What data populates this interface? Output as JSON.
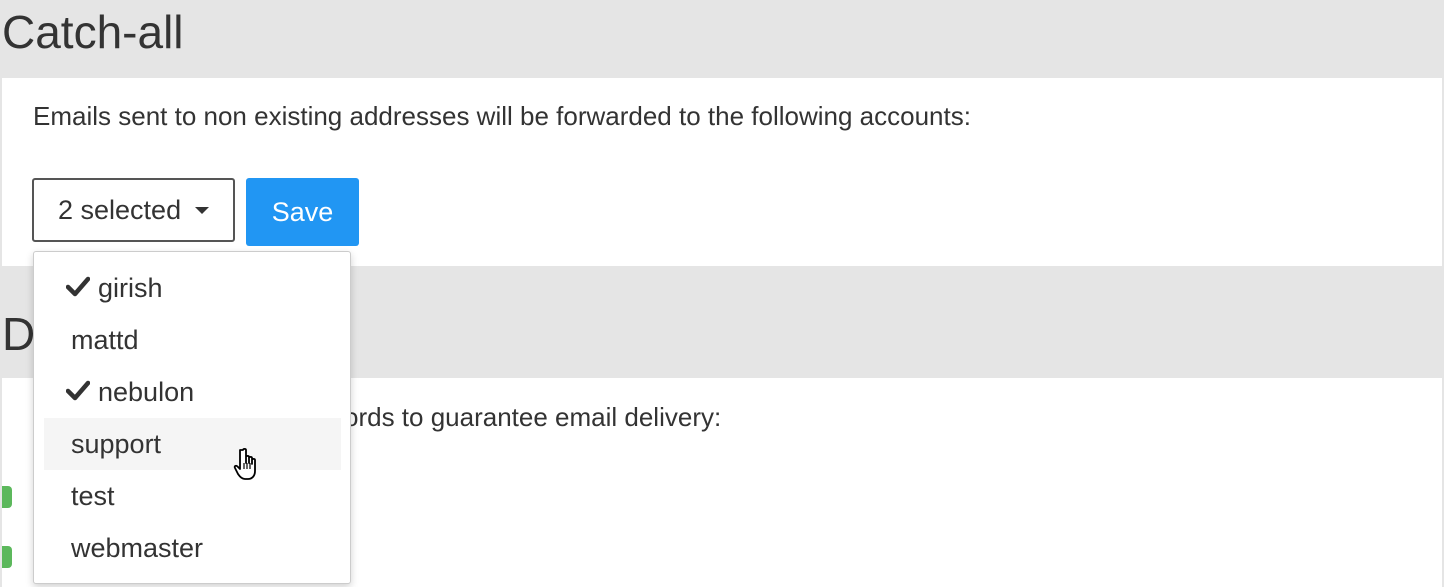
{
  "catchall": {
    "title": "Catch-all",
    "description": "Emails sent to non existing addresses will be forwarded to the following accounts:",
    "select_label": "2 selected",
    "save_label": "Save",
    "options": [
      {
        "label": "girish",
        "checked": true
      },
      {
        "label": "mattd",
        "checked": false
      },
      {
        "label": "nebulon",
        "checked": true
      },
      {
        "label": "support",
        "checked": false
      },
      {
        "label": "test",
        "checked": false
      },
      {
        "label": "webmaster",
        "checked": false
      }
    ]
  },
  "dns": {
    "title": "D",
    "description": "ords to guarantee email delivery:"
  },
  "colors": {
    "accent": "#2196f3",
    "page_bg": "#e5e5e5",
    "status_ok": "#5cb85c"
  },
  "icons": {
    "check": "check-icon",
    "caret": "caret-down-icon",
    "cursor": "hand-pointer-cursor"
  }
}
